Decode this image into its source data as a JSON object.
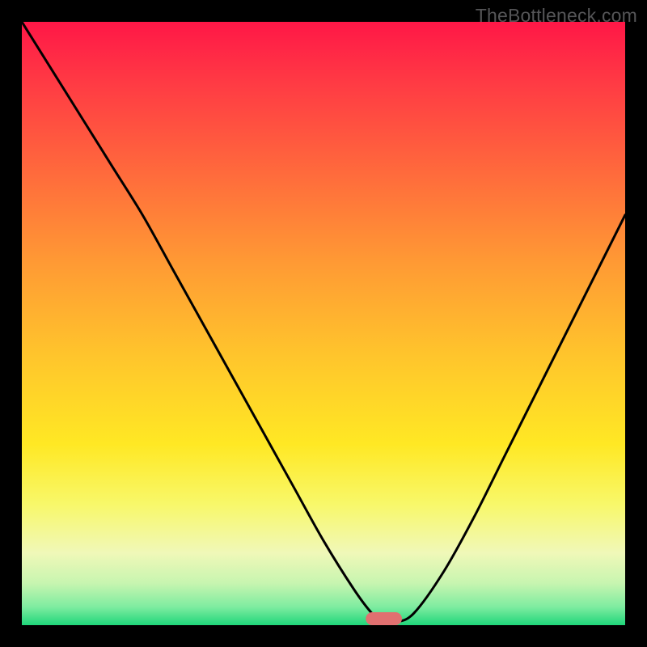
{
  "watermark": "TheBottleneck.com",
  "chart_data": {
    "type": "line",
    "title": "",
    "xlabel": "",
    "ylabel": "",
    "xlim": [
      0,
      100
    ],
    "ylim": [
      0,
      100
    ],
    "grid": false,
    "legend": false,
    "series": [
      {
        "name": "bottleneck-curve",
        "x": [
          0,
          5,
          10,
          15,
          20,
          25,
          30,
          35,
          40,
          45,
          50,
          55,
          58,
          60,
          62,
          65,
          70,
          75,
          80,
          85,
          90,
          95,
          100
        ],
        "y": [
          100,
          92,
          84,
          76,
          68,
          59,
          50,
          41,
          32,
          23,
          14,
          6,
          2,
          0.5,
          0.5,
          2,
          9,
          18,
          28,
          38,
          48,
          58,
          68
        ]
      }
    ],
    "marker": {
      "name": "optimal-zone",
      "x_center": 60,
      "width": 6,
      "color": "#e17070"
    },
    "gradient_stops": [
      {
        "offset": 0.0,
        "color": "#ff1747"
      },
      {
        "offset": 0.1,
        "color": "#ff3a44"
      },
      {
        "offset": 0.25,
        "color": "#ff6a3c"
      },
      {
        "offset": 0.4,
        "color": "#ff9a34"
      },
      {
        "offset": 0.55,
        "color": "#ffc42c"
      },
      {
        "offset": 0.7,
        "color": "#ffe824"
      },
      {
        "offset": 0.8,
        "color": "#f8f86a"
      },
      {
        "offset": 0.88,
        "color": "#f0f8b8"
      },
      {
        "offset": 0.93,
        "color": "#c8f5b0"
      },
      {
        "offset": 0.97,
        "color": "#7eeca0"
      },
      {
        "offset": 1.0,
        "color": "#1fd67a"
      }
    ]
  }
}
